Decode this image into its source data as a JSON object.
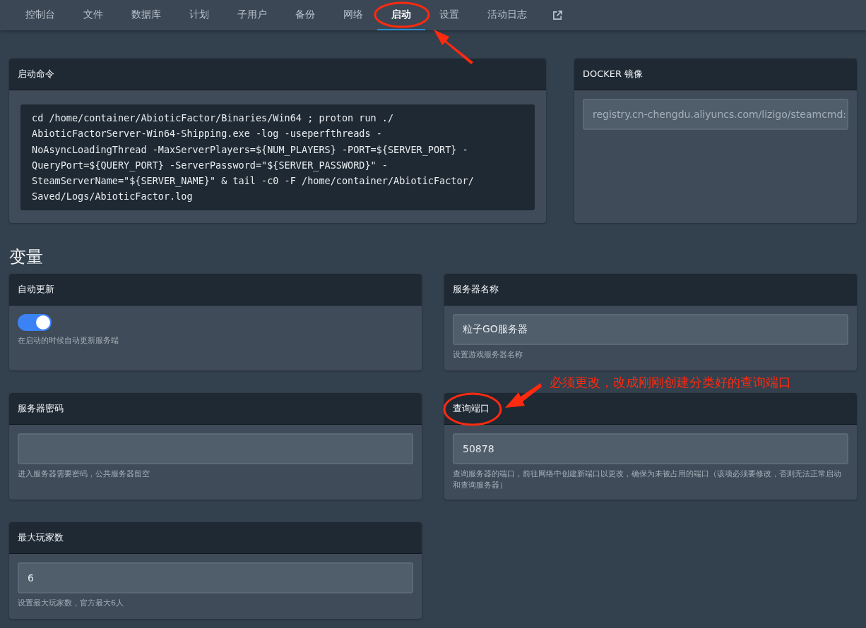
{
  "tabs": [
    {
      "label": "控制台",
      "selected": false
    },
    {
      "label": "文件",
      "selected": false
    },
    {
      "label": "数据库",
      "selected": false
    },
    {
      "label": "计划",
      "selected": false
    },
    {
      "label": "子用户",
      "selected": false
    },
    {
      "label": "备份",
      "selected": false
    },
    {
      "label": "网络",
      "selected": false
    },
    {
      "label": "启动",
      "selected": true
    },
    {
      "label": "设置",
      "selected": false
    },
    {
      "label": "活动日志",
      "selected": false
    }
  ],
  "startup": {
    "title": "启动命令",
    "command": "cd /home/container/AbioticFactor/Binaries/Win64 ; proton run ./\nAbioticFactorServer-Win64-Shipping.exe -log -useperfthreads -\nNoAsyncLoadingThread -MaxServerPlayers=${NUM_PLAYERS} -PORT=${SERVER_PORT} -\nQueryPort=${QUERY_PORT} -ServerPassword=\"${SERVER_PASSWORD}\" -\nSteamServerName=\"${SERVER_NAME}\" & tail -c0 -F /home/container/AbioticFactor/\nSaved/Logs/AbioticFactor.log"
  },
  "docker": {
    "title": "DOCKER 镜像",
    "value": "registry.cn-chengdu.aliyuncs.com/lizigo/steamcmd:"
  },
  "variables_heading": "变量",
  "variables": [
    {
      "kind": "toggle",
      "title": "自动更新",
      "on": true,
      "description": "在启动的时候自动更新服务端"
    },
    {
      "kind": "text",
      "title": "服务器名称",
      "value": "粒子GO服务器",
      "description": "设置游戏服务器名称"
    },
    {
      "kind": "text",
      "title": "服务器密码",
      "description": "进入服务器需要密码，公共服务器留空"
    },
    {
      "kind": "text",
      "title": "查询端口",
      "value": "50878",
      "description": "查询服务器的端口，前往网络中创建新端口以更改，确保为未被占用的端口（该项必须要修改，否则无法正常启动和查询服务器）"
    },
    {
      "kind": "text",
      "title": "最大玩家数",
      "value": "6",
      "description": "设置最大玩家数，官方最大6人"
    }
  ],
  "annotation": {
    "note": "必须更改，改成刚刚创建分类好的查询端口"
  }
}
